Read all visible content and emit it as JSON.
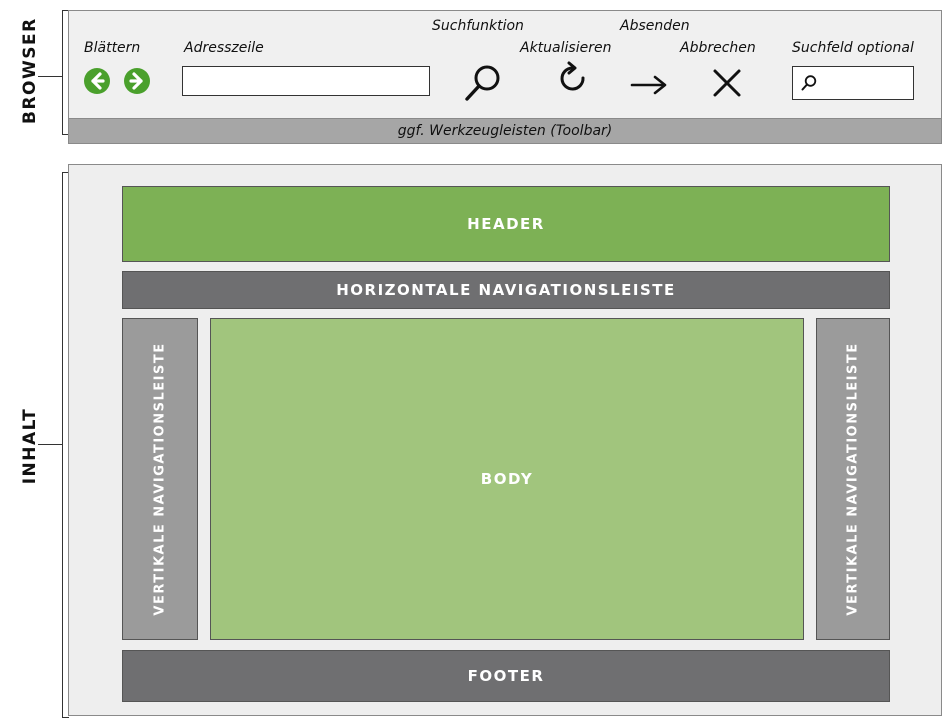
{
  "sections": {
    "browser_label": "BROWSER",
    "content_label": "INHALT"
  },
  "browser": {
    "blaettern": "Blättern",
    "adresszeile": "Adresszeile",
    "suchfunktion": "Suchfunktion",
    "aktualisieren": "Aktualisieren",
    "absenden": "Absenden",
    "abbrechen": "Abbrechen",
    "suchfeld": "Suchfeld optional",
    "toolbar": "ggf. Werkzeugleisten (Toolbar)"
  },
  "layout_blocks": {
    "header": "HEADER",
    "horizontal_nav": "HORIZONTALE NAVIGATIONSLEISTE",
    "vertical_nav_left": "VERTIKALE NAVIGATIONSLEISTE",
    "body": "BODY",
    "vertical_nav_right": "VERTIKALE NAVIGATIONSLEISTE",
    "footer": "FOOTER"
  },
  "colors": {
    "header_green": "#7db155",
    "body_green": "#a1c57d",
    "nav_dark_gray": "#6f6f71",
    "vertical_nav_gray": "#9b9b9b",
    "nav_icon_green": "#4aa02c"
  },
  "icons": [
    "arrow-left-icon",
    "arrow-right-icon",
    "search-icon",
    "refresh-icon",
    "submit-arrow-icon",
    "close-icon",
    "search-field-icon"
  ]
}
